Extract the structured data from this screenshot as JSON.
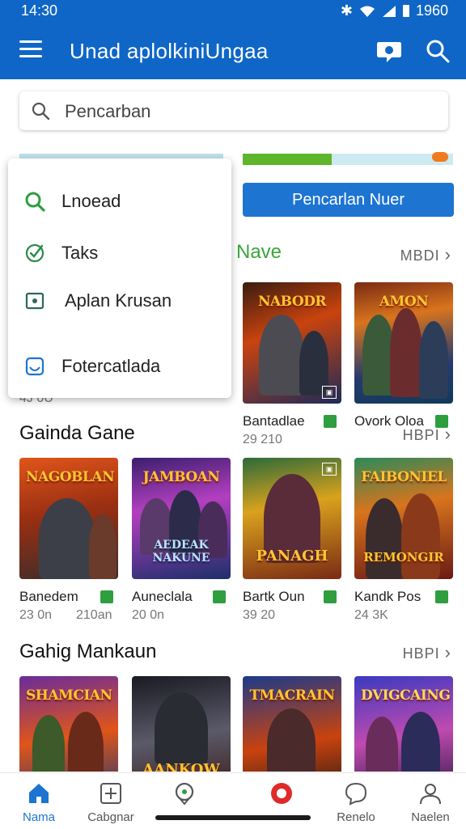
{
  "status": {
    "time": "14:30",
    "battery": "1960"
  },
  "appbar": {
    "title": "Unad aplolkiniUngaa"
  },
  "search": {
    "placeholder": "Pencarban"
  },
  "banner": {
    "button_label": "Pencarlan Nuer"
  },
  "dropdown": {
    "items": [
      {
        "label": "Lnoead",
        "icon": "search-icon"
      },
      {
        "label": "Taks",
        "icon": "check-circle-icon"
      },
      {
        "label": "Aplan Krusan",
        "icon": "app-box-icon"
      },
      {
        "label": "Fotercatlada",
        "icon": "shield-icon"
      }
    ]
  },
  "section1": {
    "title": "Nave",
    "more": "MBDI",
    "partial_sub": "4J 0U",
    "cards": [
      {
        "name": "Bantadlae",
        "sub": "29 210",
        "logo": "NABODR"
      },
      {
        "name": "Ovork Oloa",
        "sub": "",
        "logo": "AMON"
      }
    ]
  },
  "section2": {
    "title": "Gainda Gane",
    "more": "HBPI",
    "cards": [
      {
        "name": "Banedem",
        "sub": "23 0n",
        "logo": "NAGOBLAN",
        "logo2": ""
      },
      {
        "name": "Auneclala",
        "sub": "20 0n",
        "logo": "JAMBOAN",
        "logo2": "AEDEAK NAKUNE"
      },
      {
        "name": "Bartk Oun",
        "sub": "39 20",
        "logo": "",
        "logo2": "PANAGH"
      },
      {
        "name": "Kandk Pos",
        "sub": "24 3K",
        "logo": "FAIBONIEL",
        "logo2": "REMONGIR"
      }
    ],
    "extra_sub": "210an"
  },
  "section3": {
    "title": "Gahig Mankaun",
    "more": "HBPI",
    "cards": [
      {
        "logo": "SHAMCIAN"
      },
      {
        "logo": "AANKOW"
      },
      {
        "logo": "TMACRAIN"
      },
      {
        "logo": "DVIGCAING"
      }
    ]
  },
  "nav": {
    "items": [
      {
        "label": "Nama",
        "icon": "home-icon",
        "active": true
      },
      {
        "label": "Cabgnar",
        "icon": "category-icon",
        "active": false
      },
      {
        "label": "",
        "icon": "map-pin-icon",
        "active": false
      },
      {
        "label": "",
        "icon": "game-icon",
        "active": false
      },
      {
        "label": "Renelo",
        "icon": "chat-icon",
        "active": false
      },
      {
        "label": "Naelen",
        "icon": "profile-icon",
        "active": false
      }
    ]
  },
  "colors": {
    "primary": "#0f66c7",
    "button": "#1d74d1",
    "accent_green": "#2e9e3f"
  }
}
